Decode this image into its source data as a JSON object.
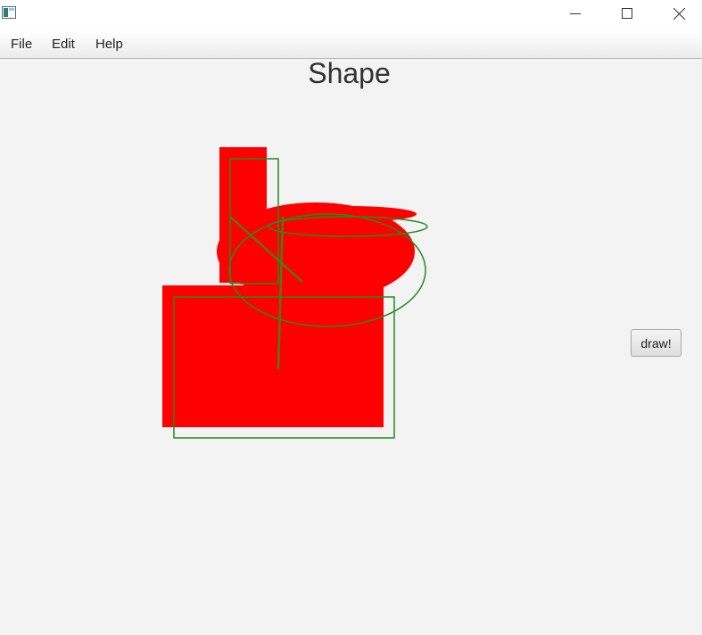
{
  "window": {
    "icon": "app-window-icon",
    "controls": {
      "minimize_icon": "minimize-icon",
      "maximize_icon": "maximize-icon",
      "close_icon": "close-icon"
    }
  },
  "menubar": {
    "items": [
      {
        "label": "File"
      },
      {
        "label": "Edit"
      },
      {
        "label": "Help"
      }
    ]
  },
  "main": {
    "title": "Shape",
    "draw_button_label": "draw!"
  },
  "colors": {
    "fill_shapes": "#ff0000",
    "outline_shapes": "#228b22",
    "background": "#f3f3f3"
  }
}
